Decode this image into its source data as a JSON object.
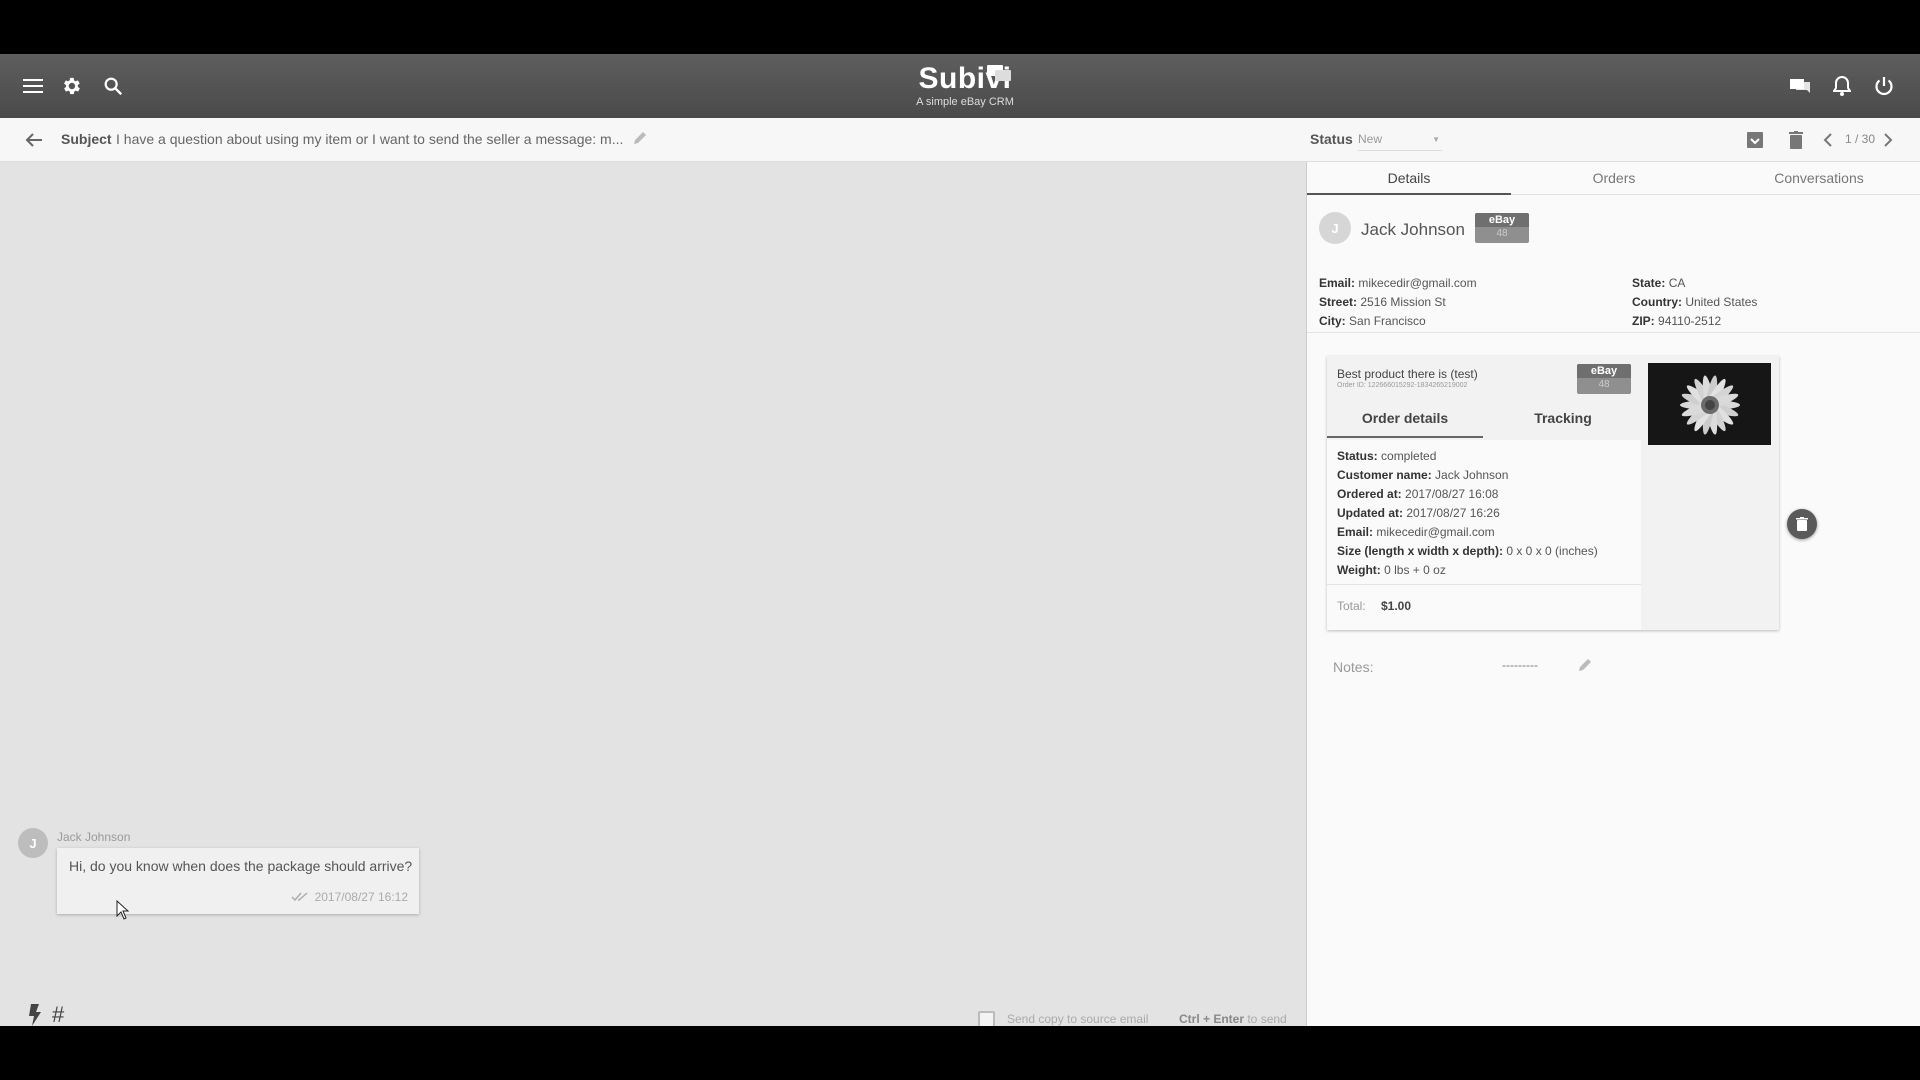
{
  "app": {
    "name": "Subivi",
    "tagline": "A simple eBay CRM"
  },
  "subject": {
    "label": "Subject",
    "text": "I have a question about using my item or I want to send the seller a message: m..."
  },
  "status": {
    "label": "Status",
    "value": "New"
  },
  "pager": {
    "text": "1 / 30"
  },
  "conversation": {
    "messages": [
      {
        "avatar": "J",
        "sender": "Jack Johnson",
        "text": "Hi, do you know when does the package should arrive?",
        "timestamp": "2017/08/27 16:12"
      }
    ]
  },
  "composer": {
    "copy_label": "Send copy to source email",
    "send_hint_key": "Ctrl + Enter",
    "send_hint_suffix": " to send",
    "hash": "#"
  },
  "panel": {
    "tabs": [
      "Details",
      "Orders",
      "Conversations"
    ],
    "active_tab": "Details",
    "customer": {
      "avatar": "J",
      "name": "Jack Johnson",
      "badge_label": "eBay",
      "badge_count": "48",
      "fields": {
        "email_label": "Email:",
        "email": "mikecedir@gmail.com",
        "street_label": "Street:",
        "street": "2516 Mission St",
        "city_label": "City:",
        "city": "San Francisco",
        "state_label": "State:",
        "state": "CA",
        "country_label": "Country:",
        "country": "United States",
        "zip_label": "ZIP:",
        "zip": "94110-2512"
      }
    },
    "order": {
      "title": "Best product there is (test)",
      "order_id": "Order ID: 122666015292-1834265219002",
      "badge_label": "eBay",
      "badge_count": "48",
      "tabs": [
        "Order details",
        "Tracking"
      ],
      "active_tab": "Order details",
      "details": {
        "status_label": "Status:",
        "status": "completed",
        "customer_label": "Customer name:",
        "customer": "Jack Johnson",
        "ordered_label": "Ordered at:",
        "ordered": "2017/08/27 16:08",
        "updated_label": "Updated at:",
        "updated": "2017/08/27 16:26",
        "email_label": "Email:",
        "email": "mikecedir@gmail.com",
        "size_label": "Size (length x width x depth):",
        "size": "0 x 0 x 0 (inches)",
        "weight_label": "Weight:",
        "weight": "0 lbs + 0 oz"
      },
      "total_label": "Total:",
      "total": "$1.00"
    },
    "notes": {
      "label": "Notes:",
      "value": "---------"
    }
  },
  "icons": {
    "menu": "menu-icon",
    "settings": "gear-icon",
    "search": "search-icon",
    "chat": "chat-icon",
    "bell": "bell-icon",
    "power": "power-icon"
  }
}
